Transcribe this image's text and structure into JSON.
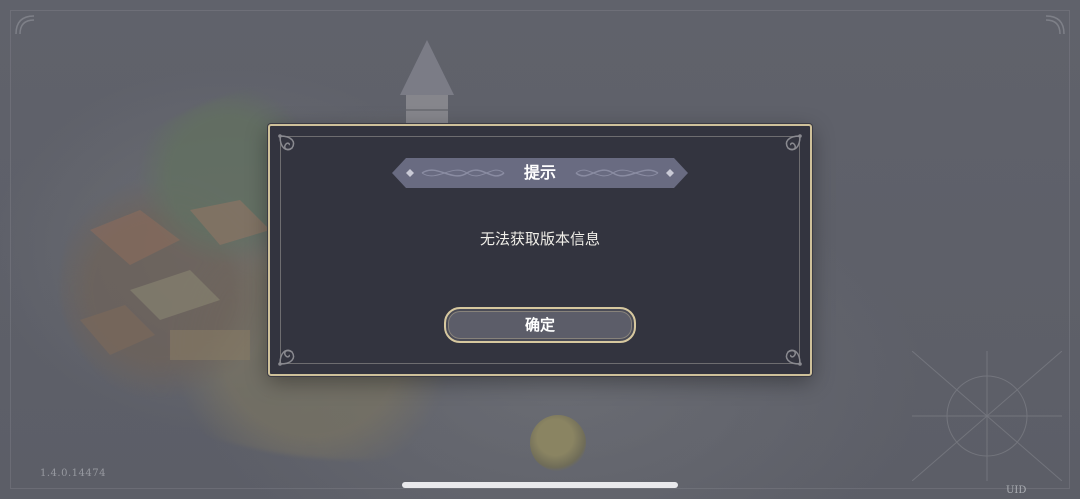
{
  "dialog": {
    "title": "提示",
    "message": "无法获取版本信息",
    "confirm_label": "确定"
  },
  "footer": {
    "version": "1.4.0.14474",
    "uid_label": "UID"
  },
  "colors": {
    "dialog_bg": "#33343f",
    "gold_border": "#cfc19a",
    "banner_bg": "#696b81",
    "button_bg": "#5c5d69",
    "overlay_bg": "#5b5d66"
  }
}
